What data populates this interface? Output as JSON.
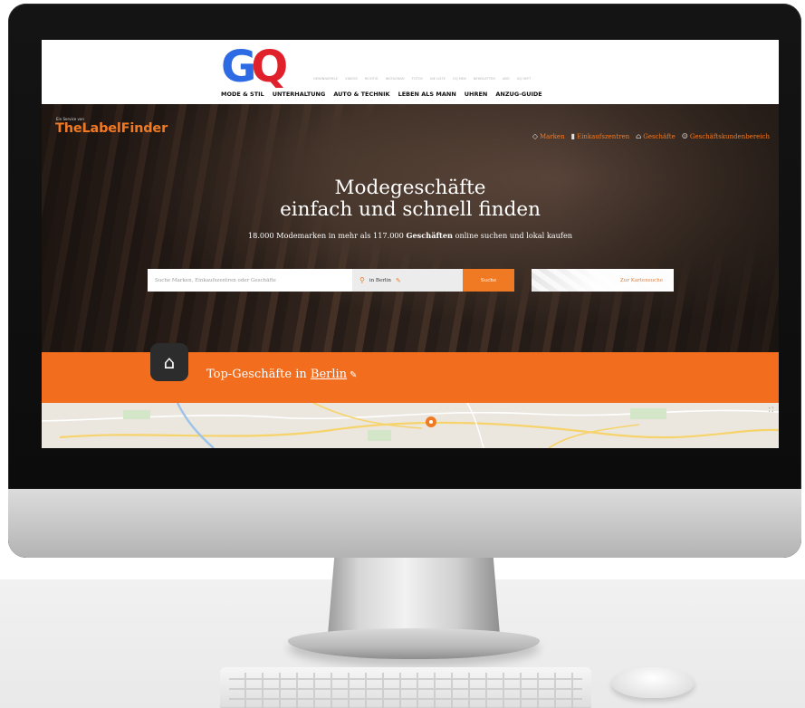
{
  "gq": {
    "logo_g": "G",
    "logo_q": "Q",
    "small_nav": [
      "GEWINNSPIELE",
      "VIDEOS",
      "RICHTIG",
      "INSTAGRAM",
      "FOTOS",
      "DIE LISTE",
      "GQ MEN",
      "NEWSLETTER",
      "ABO",
      "GQ HEFT"
    ],
    "main_nav": [
      "MODE & STIL",
      "UNTERHALTUNG",
      "AUTO & TECHNIK",
      "LEBEN ALS MANN",
      "UHREN",
      "ANZUG-GUIDE"
    ]
  },
  "hero": {
    "tagline_small": "Ein Service von",
    "brand": "TheLabelFinder",
    "nav": [
      {
        "icon": "tag-icon",
        "glyph": "◇",
        "label": "Marken"
      },
      {
        "icon": "building-icon",
        "glyph": "▮",
        "label": "Einkaufszentren"
      },
      {
        "icon": "store-icon",
        "glyph": "⌂",
        "label": "Geschäfte"
      },
      {
        "icon": "user-icon",
        "glyph": "☺",
        "label": "Geschäftskundenbereich"
      }
    ],
    "title_line1": "Modegeschäfte",
    "title_line2": "einfach und schnell finden",
    "sub_prefix": "18.000 Modemarken in mehr als 117.000 ",
    "sub_bold": "Geschäften",
    "sub_suffix": " online suchen und lokal kaufen",
    "search_placeholder": "Suche Marken, Einkaufszentren oder Geschäfte",
    "location_value": "in Berlin",
    "search_button": "Suche",
    "map_search_label": "Zur Kartensuche"
  },
  "band": {
    "title_prefix": "Top-Geschäfte in ",
    "city": "Berlin"
  },
  "colors": {
    "brand_orange": "#f07a24",
    "band_orange": "#f26d1d",
    "gq_blue": "#2d6be5",
    "gq_red": "#e0212b"
  }
}
